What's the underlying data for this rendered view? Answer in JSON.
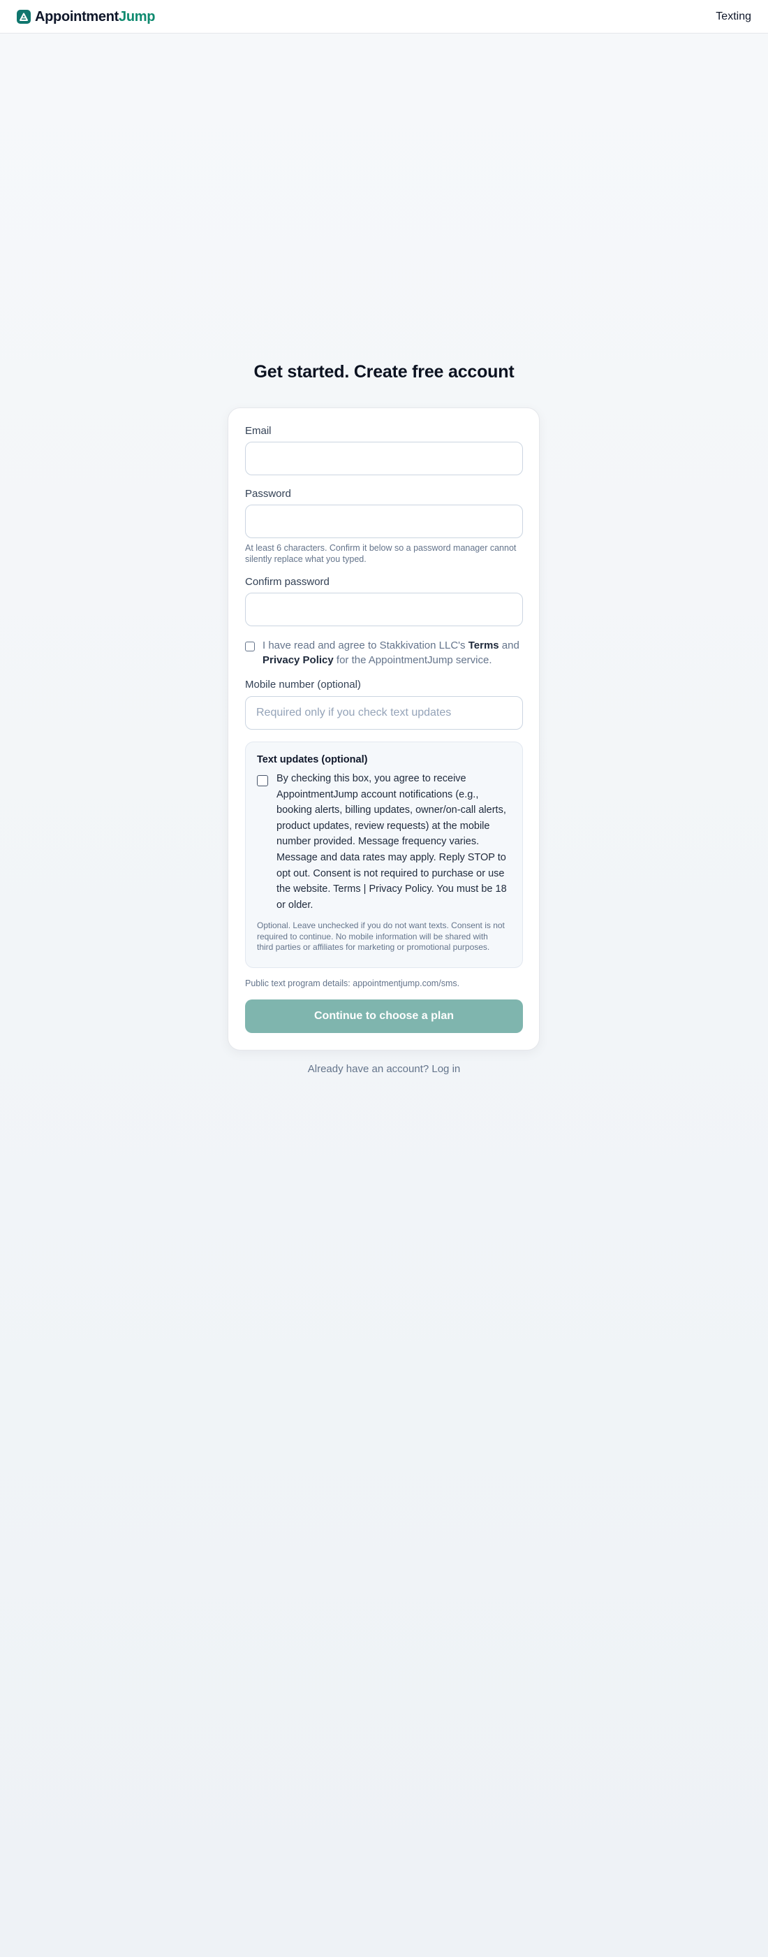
{
  "header": {
    "brand_part1": "Appointment",
    "brand_part2": "Jump",
    "logo_icon": "mountain-logo-icon",
    "nav_link": "Texting"
  },
  "page": {
    "title": "Get started. Create free account"
  },
  "form": {
    "email_label": "Email",
    "email_value": "",
    "password_label": "Password",
    "password_value": "",
    "password_help": "At least 6 characters. Confirm it below so a password manager cannot silently replace what you typed.",
    "confirm_label": "Confirm password",
    "confirm_value": "",
    "agree": {
      "checked": false,
      "prefix": "I have read and agree to Stakkivation LLC's ",
      "terms": "Terms",
      "and": " and",
      "privacy": "Privacy Policy",
      "suffix": " for the AppointmentJump service."
    },
    "mobile_label": "Mobile number (optional)",
    "mobile_placeholder": "Required only if you check text updates",
    "mobile_value": "",
    "sms": {
      "title": "Text updates (optional)",
      "checked": false,
      "consent": "By checking this box, you agree to receive AppointmentJump account notifications (e.g., booking alerts, billing updates, owner/on-call alerts, product updates, review requests) at the mobile number provided. Message frequency varies. Message and data rates may apply. Reply STOP to opt out. Consent is not required to purchase or use the website. Terms | Privacy Policy. You must be 18 or older.",
      "note": "Optional. Leave unchecked if you do not want texts. Consent is not required to continue. No mobile information will be shared with third parties or affiliates for marketing or promotional purposes."
    },
    "program_details": "Public text program details: appointmentjump.com/sms.",
    "submit_label": "Continue to choose a plan"
  },
  "footer": {
    "login_prompt": "Already have an account? Log in"
  },
  "colors": {
    "brand_dark": "#0f172a",
    "brand_accent": "#0f8a6f",
    "logo_bg": "#0f766e",
    "button_bg": "#7fb5ae"
  }
}
